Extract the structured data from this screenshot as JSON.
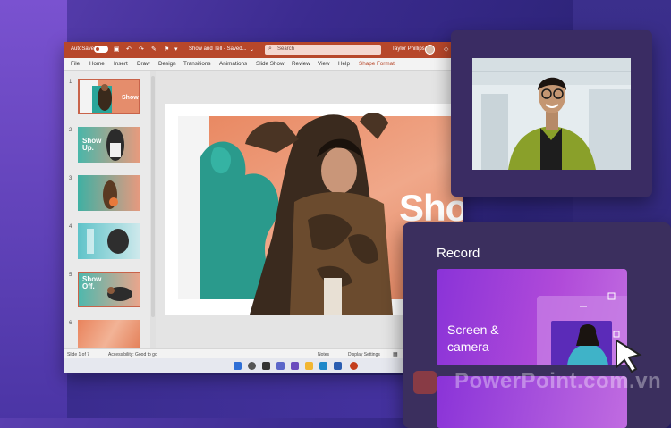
{
  "app": {
    "autosave_label": "AutoSave",
    "document_title": "Show and Tell - Saved...",
    "search_placeholder": "Search",
    "user_name": "Taylor Phillips"
  },
  "menu": [
    "File",
    "Home",
    "Insert",
    "Draw",
    "Design",
    "Transitions",
    "Animations",
    "Slide Show",
    "Review",
    "View",
    "Help",
    "Shape Format"
  ],
  "thumbnails": [
    {
      "num": "1",
      "text": "Show."
    },
    {
      "num": "2",
      "text": "Show Up."
    },
    {
      "num": "3",
      "text": ""
    },
    {
      "num": "4",
      "text": ""
    },
    {
      "num": "5",
      "text": "Show Off."
    },
    {
      "num": "6",
      "text": ""
    }
  ],
  "slide": {
    "title": "Show."
  },
  "status": {
    "slide_count": "Slide 1 of 7",
    "accessibility": "Accessibility: Good to go",
    "notes": "Notes",
    "display_settings": "Display Settings"
  },
  "record_panel": {
    "title": "Record",
    "card_label": "Screen & camera"
  },
  "watermark": "PowerPoint.com.vn",
  "colors": {
    "ppt_accent": "#b7472a",
    "record_card": "#8a33d8",
    "panel_bg": "#3a2c63"
  }
}
